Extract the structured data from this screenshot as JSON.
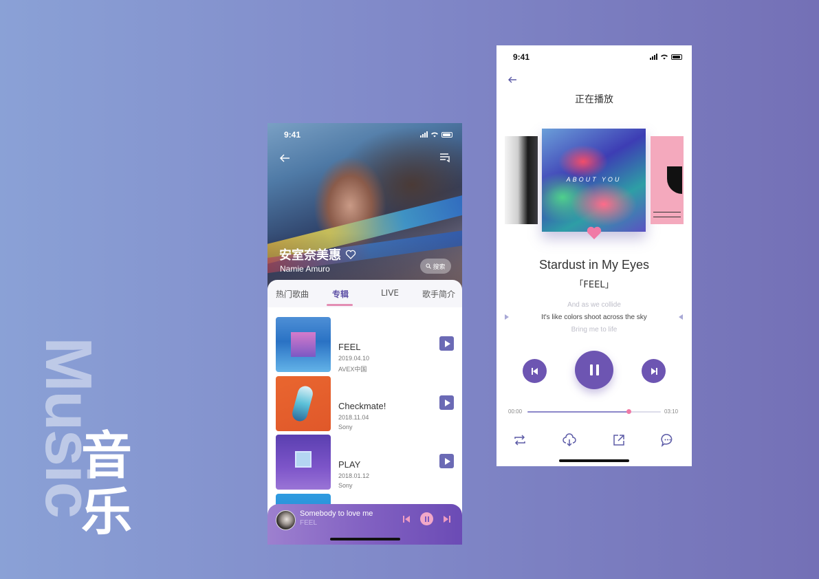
{
  "decor": {
    "music_word": "Music",
    "cn_word": "音乐"
  },
  "phone1": {
    "status_time": "9:41",
    "artist_cn": "安室奈美惠",
    "artist_en": "Namie Amuro",
    "search_placeholder": "搜索",
    "tabs": [
      {
        "label": "热门歌曲",
        "active": false
      },
      {
        "label": "专辑",
        "active": true
      },
      {
        "label": "LIVE",
        "active": false
      },
      {
        "label": "歌手简介",
        "active": false
      }
    ],
    "albums": [
      {
        "name": "FEEL",
        "date": "2019.04.10",
        "label": "AVEX中国"
      },
      {
        "name": "Checkmate!",
        "date": "2018.11.04",
        "label": "Sony"
      },
      {
        "name": "PLAY",
        "date": "2018.01.12",
        "label": "Sony"
      }
    ],
    "mini_player": {
      "title": "Somebody to love me",
      "album": "FEEL"
    }
  },
  "phone2": {
    "status_time": "9:41",
    "title": "正在播放",
    "cover_text": "ABOUT YOU",
    "song_title": "Stardust in My Eyes",
    "album": "「FEEL」",
    "lyrics": {
      "prev": "And as we collide",
      "current": "It's like colors shoot across the sky",
      "next": "Bring me to life"
    },
    "time_elapsed": "00:00",
    "time_total": "03:10",
    "progress": 0.76
  },
  "colors": {
    "accent": "#6d55b2",
    "pink": "#f07aa6"
  }
}
